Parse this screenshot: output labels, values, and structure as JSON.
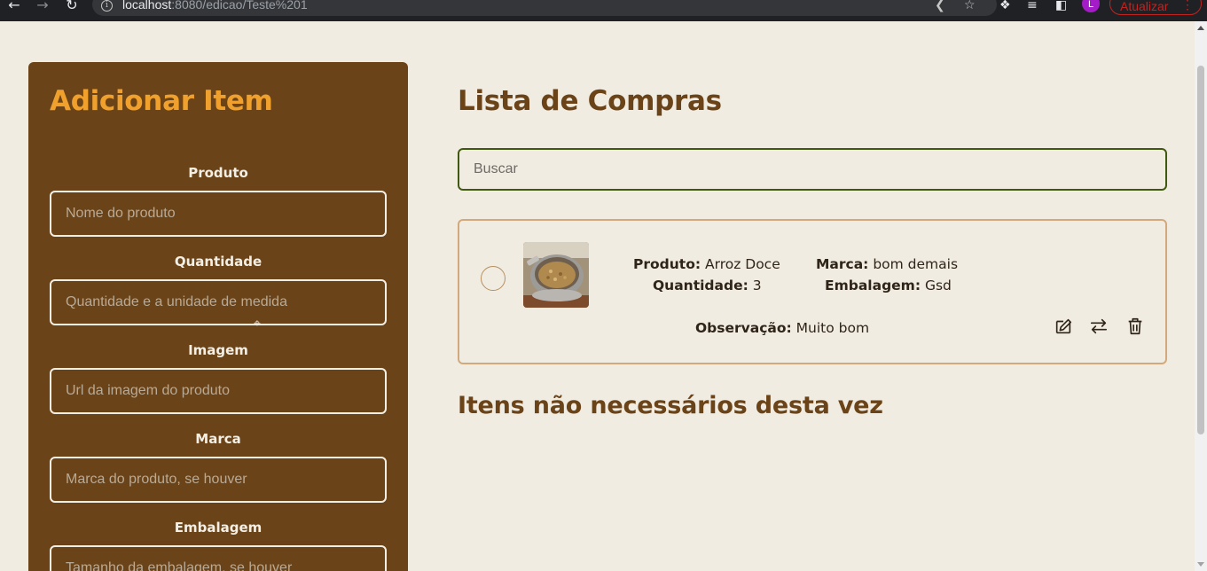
{
  "browser": {
    "url_host": "localhost",
    "url_path": ":8080/edicao/Teste%201",
    "avatar_letter": "L",
    "update_label": "Atualizar",
    "icons": [
      "back-icon",
      "forward-icon",
      "reload-icon",
      "info-icon",
      "share-icon",
      "star-icon",
      "extensions-icon",
      "reading-list-icon",
      "sidepanel-icon",
      "menu-icon"
    ]
  },
  "sidebar": {
    "title": "Adicionar Item",
    "fields": [
      {
        "label": "Produto",
        "placeholder": "Nome do produto"
      },
      {
        "label": "Quantidade",
        "placeholder": "Quantidade e a unidade de medida"
      },
      {
        "label": "Imagem",
        "placeholder": "Url da imagem do produto"
      },
      {
        "label": "Marca",
        "placeholder": "Marca do produto, se houver"
      },
      {
        "label": "Embalagem",
        "placeholder": "Tamanho da embalagem, se houver"
      }
    ]
  },
  "main": {
    "title": "Lista de Compras",
    "search_placeholder": "Buscar",
    "items": [
      {
        "produto_label": "Produto:",
        "produto": "Arroz Doce",
        "quantidade_label": "Quantidade:",
        "quantidade": "3",
        "marca_label": "Marca:",
        "marca": "bom demais",
        "embalagem_label": "Embalagem:",
        "embalagem": "Gsd",
        "observacao_label": "Observação:",
        "observacao": "Muito bom",
        "actions": [
          "edit-icon",
          "swap-icon",
          "trash-icon"
        ]
      }
    ],
    "not_needed_title": "Itens não necessários desta vez"
  },
  "colors": {
    "background": "#f1ece2",
    "sidebar": "#6b4318",
    "accent": "#f0a12d",
    "card_border": "#d2a97c",
    "search_border": "#3f5a10"
  }
}
